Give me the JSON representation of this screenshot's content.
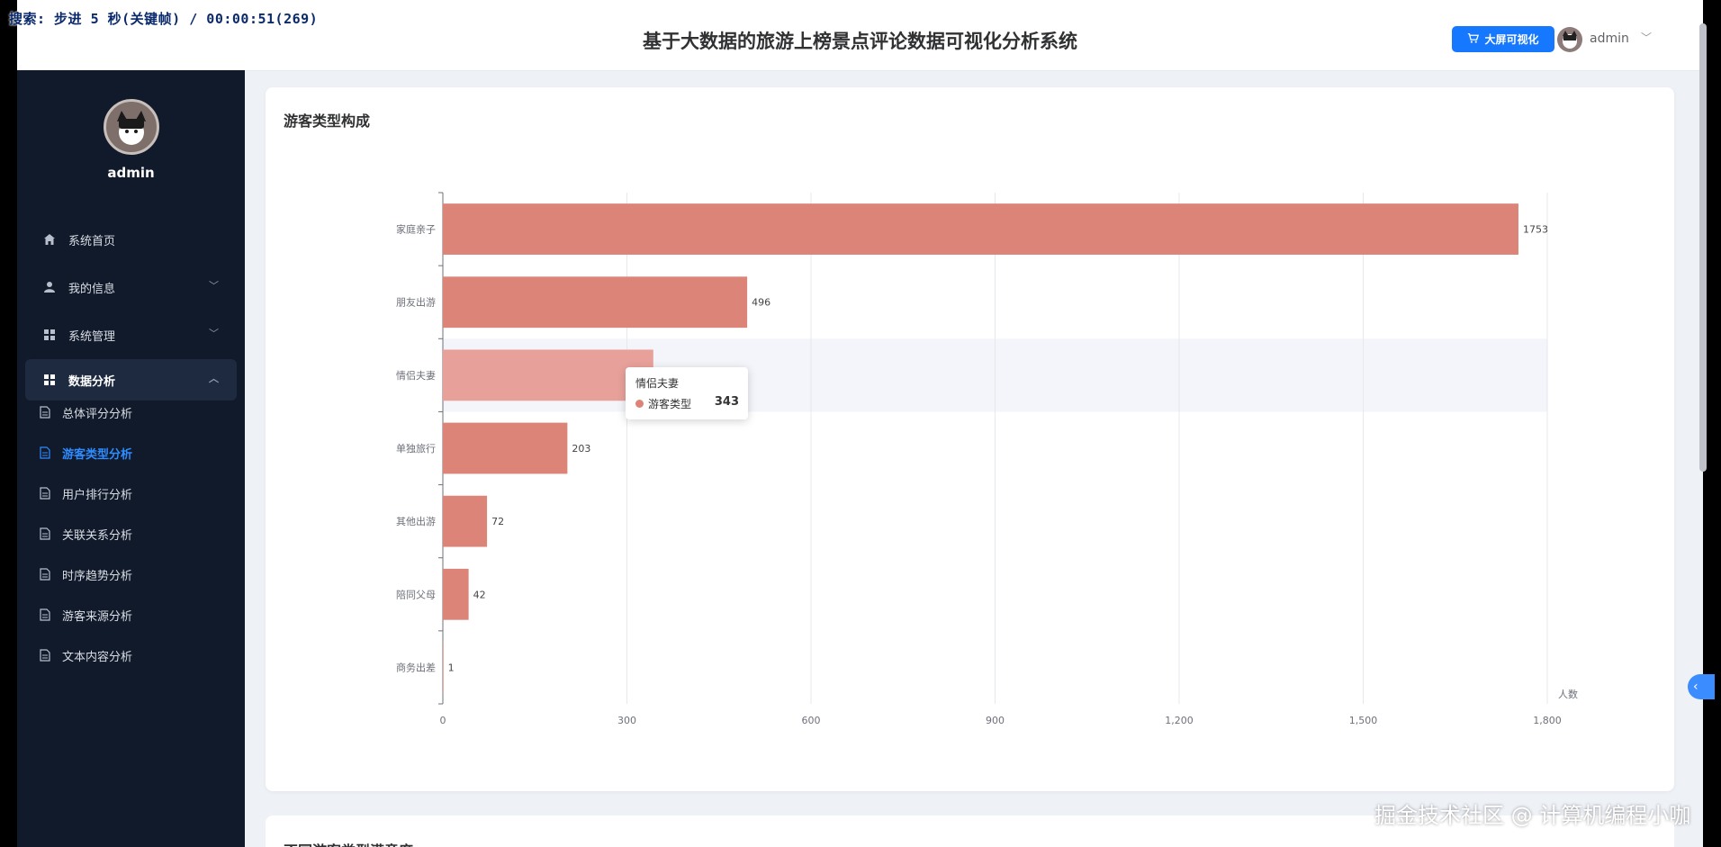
{
  "overlay": {
    "text": "搜索: 步进 5 秒(关键帧) / 00:00:51(269)"
  },
  "header": {
    "title": "基于大数据的旅游上榜景点评论数据可视化分析系统",
    "big_screen_label": "大屏可视化",
    "user": "admin"
  },
  "sidebar": {
    "user": "admin",
    "menu": [
      {
        "label": "系统首页",
        "icon": "home-icon"
      },
      {
        "label": "我的信息",
        "icon": "user-icon"
      },
      {
        "label": "系统管理",
        "icon": "grid-icon"
      },
      {
        "label": "数据分析",
        "icon": "grid-icon"
      }
    ],
    "submenu": [
      {
        "label": "总体评分分析"
      },
      {
        "label": "游客类型分析"
      },
      {
        "label": "用户排行分析"
      },
      {
        "label": "关联关系分析"
      },
      {
        "label": "时序趋势分析"
      },
      {
        "label": "游客来源分析"
      },
      {
        "label": "文本内容分析"
      }
    ],
    "selected_submenu": "游客类型分析"
  },
  "card": {
    "title": "游客类型构成"
  },
  "card2": {
    "title": "不同游客类型满意度"
  },
  "chart_data": {
    "type": "bar",
    "orientation": "horizontal",
    "categories": [
      "家庭亲子",
      "朋友出游",
      "情侣夫妻",
      "单独旅行",
      "其他出游",
      "陪同父母",
      "商务出差"
    ],
    "values": [
      1753,
      496,
      343,
      203,
      72,
      42,
      1
    ],
    "series_name": "游客类型",
    "xunit": "人数",
    "xlim": [
      0,
      1800
    ],
    "xticks": [
      0,
      300,
      600,
      900,
      1200,
      1500,
      1800
    ],
    "xtick_labels": [
      "0",
      "300",
      "600",
      "900",
      "1,200",
      "1,500",
      "1,800"
    ],
    "grid": "vertical",
    "bar_color": "#dd8478",
    "highlight_color": "#e8a19a",
    "highlighted_category": "情侣夫妻"
  },
  "tooltip": {
    "title": "情侣夫妻",
    "series": "游客类型",
    "value": "343"
  },
  "watermark": "掘金技术社区 @ 计算机编程小咖"
}
